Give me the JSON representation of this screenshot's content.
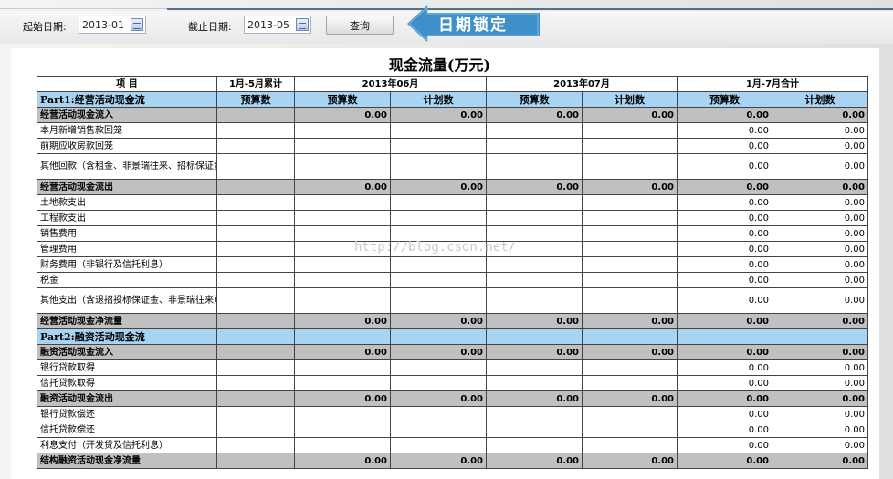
{
  "toolbar": {
    "start_label": "起始日期:",
    "start_value": "2013-01",
    "end_label": "截止日期:",
    "end_value": "2013-05",
    "query_label": "查询",
    "lock_label": "日期锁定"
  },
  "report": {
    "title": "现金流量(万元)",
    "watermark": "http://blog.csdn.net/",
    "header_top": [
      "项  目",
      "1月-5月累计",
      "2013年06月",
      "2013年07月",
      "1月-7月合计"
    ],
    "header_sub": [
      "预算数",
      "预算数",
      "计划数",
      "预算数",
      "计划数",
      "预算数",
      "计划数"
    ],
    "rows": [
      {
        "type": "part",
        "label": "Part1:经营活动现金流",
        "values": [
          "",
          "",
          "",
          "",
          "",
          "",
          ""
        ]
      },
      {
        "type": "sub",
        "label": "经营活动现金流入",
        "values": [
          "",
          "0.00",
          "0.00",
          "0.00",
          "0.00",
          "0.00",
          "0.00"
        ]
      },
      {
        "type": "row",
        "label": "本月新增销售款回笼",
        "values": [
          "",
          "",
          "",
          "",
          "",
          "0.00",
          "0.00"
        ]
      },
      {
        "type": "row",
        "label": "前期应收房款回笼",
        "values": [
          "",
          "",
          "",
          "",
          "",
          "0.00",
          "0.00"
        ]
      },
      {
        "type": "tall",
        "label": "其他回款（含租金、非景瑞往来、招标保证金等）",
        "values": [
          "",
          "",
          "",
          "",
          "",
          "0.00",
          "0.00"
        ]
      },
      {
        "type": "sub",
        "label": "经营活动现金流出",
        "values": [
          "",
          "0.00",
          "0.00",
          "0.00",
          "0.00",
          "0.00",
          "0.00"
        ]
      },
      {
        "type": "row",
        "label": "土地款支出",
        "values": [
          "",
          "",
          "",
          "",
          "",
          "0.00",
          "0.00"
        ]
      },
      {
        "type": "row",
        "label": "工程款支出",
        "values": [
          "",
          "",
          "",
          "",
          "",
          "0.00",
          "0.00"
        ]
      },
      {
        "type": "row",
        "label": "销售费用",
        "values": [
          "",
          "",
          "",
          "",
          "",
          "0.00",
          "0.00"
        ]
      },
      {
        "type": "row",
        "label": "管理费用",
        "values": [
          "",
          "",
          "",
          "",
          "",
          "0.00",
          "0.00"
        ]
      },
      {
        "type": "row",
        "label": "财务费用（非银行及信托利息）",
        "values": [
          "",
          "",
          "",
          "",
          "",
          "0.00",
          "0.00"
        ]
      },
      {
        "type": "row",
        "label": "税金",
        "values": [
          "",
          "",
          "",
          "",
          "",
          "0.00",
          "0.00"
        ]
      },
      {
        "type": "tall",
        "label": "其他支出（含退招投标保证金、非景瑞往来）",
        "values": [
          "",
          "",
          "",
          "",
          "",
          "0.00",
          "0.00"
        ]
      },
      {
        "type": "total",
        "label": "经营活动现金净流量",
        "values": [
          "",
          "0.00",
          "0.00",
          "0.00",
          "0.00",
          "0.00",
          "0.00"
        ]
      },
      {
        "type": "part",
        "label": "Part2:融资活动现金流",
        "values": [
          "",
          "",
          "",
          "",
          "",
          "",
          ""
        ]
      },
      {
        "type": "sub",
        "label": "融资活动现金流入",
        "values": [
          "",
          "0.00",
          "0.00",
          "0.00",
          "0.00",
          "0.00",
          "0.00"
        ]
      },
      {
        "type": "row",
        "label": "银行贷款取得",
        "values": [
          "",
          "",
          "",
          "",
          "",
          "0.00",
          "0.00"
        ]
      },
      {
        "type": "row",
        "label": "信托贷款取得",
        "values": [
          "",
          "",
          "",
          "",
          "",
          "0.00",
          "0.00"
        ]
      },
      {
        "type": "sub",
        "label": "融资活动现金流出",
        "values": [
          "",
          "0.00",
          "0.00",
          "0.00",
          "0.00",
          "0.00",
          "0.00"
        ]
      },
      {
        "type": "row",
        "label": "银行贷款偿还",
        "values": [
          "",
          "",
          "",
          "",
          "",
          "0.00",
          "0.00"
        ]
      },
      {
        "type": "row",
        "label": "信托贷款偿还",
        "values": [
          "",
          "",
          "",
          "",
          "",
          "0.00",
          "0.00"
        ]
      },
      {
        "type": "row",
        "label": "利息支付（开发贷及信托利息）",
        "values": [
          "",
          "",
          "",
          "",
          "",
          "0.00",
          "0.00"
        ]
      },
      {
        "type": "total",
        "label": "结构融资活动现金净流量",
        "values": [
          "",
          "0.00",
          "0.00",
          "0.00",
          "0.00",
          "0.00",
          "0.00"
        ]
      }
    ]
  },
  "colors": {
    "part_row": "#a9d3f2",
    "sub_row": "#c0c0c0",
    "lock_banner": "#3f8fc9"
  },
  "icons": {
    "calendar": "calendar-icon",
    "lock_arrow": "arrow-left-icon"
  }
}
